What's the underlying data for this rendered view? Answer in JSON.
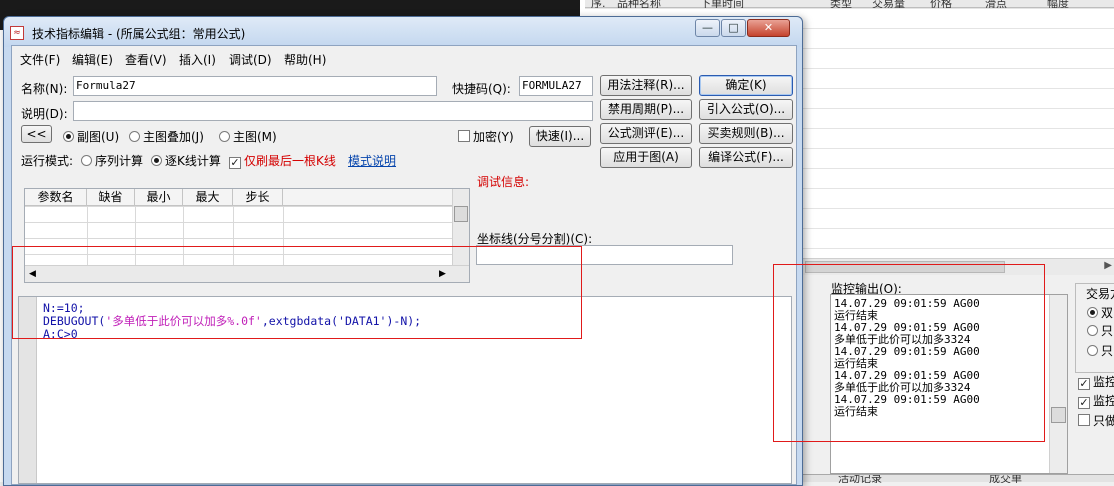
{
  "background": {
    "grid_headers": [
      "序.",
      "品种名称",
      "下单时间",
      "类型",
      "交易量",
      "价格",
      "滑点",
      "幅度"
    ],
    "monitor": {
      "label": "监控输出(O):",
      "lines": [
        "14.07.29 09:01:59 AG00",
        "运行结束",
        "14.07.29 09:01:59 AG00",
        "多单低于此价可以加多3324",
        "14.07.29 09:01:59 AG00",
        "运行结束",
        "14.07.29 09:01:59 AG00",
        "多单低于此价可以加多3324",
        "14.07.29 09:01:59 AG00",
        "运行结束"
      ]
    },
    "trade_group": {
      "label": "交易方",
      "radios": [
        "双",
        "只",
        "只"
      ]
    },
    "checks": [
      "监控",
      "监控",
      "只做"
    ],
    "bottom_tabs": [
      "活动记录",
      "成交单"
    ]
  },
  "window": {
    "title": "技术指标编辑 - (所属公式组：常用公式)",
    "caption_buttons": {
      "minimize": "—",
      "maximize": "□",
      "close": "✕"
    },
    "menu": [
      "文件(F)",
      "编辑(E)",
      "查看(V)",
      "插入(I)",
      "调试(D)",
      "帮助(H)"
    ],
    "name_label": "名称(N):",
    "name_value": "Formula27",
    "shortcut_label": "快捷码(Q):",
    "shortcut_value": "FORMULA27",
    "desc_label": "说明(D):",
    "desc_value": "",
    "collapse_button": "<<",
    "chart_radios": [
      {
        "label": "副图(U)",
        "checked": true
      },
      {
        "label": "主图叠加(J)",
        "checked": false
      },
      {
        "label": "主图(M)",
        "checked": false
      }
    ],
    "encrypt_label": "加密(Y)",
    "encrypt_checked": false,
    "fast_button": "快速(I)...",
    "run_mode_label": "运行模式:",
    "run_mode_radios": [
      {
        "label": "序列计算",
        "checked": false
      },
      {
        "label": "逐K线计算",
        "checked": true
      }
    ],
    "last_bar_check_label": "仅刷最后一根K线",
    "last_bar_checked": true,
    "mode_link": "模式说明",
    "param_headers": [
      "参数名",
      "缺省",
      "最小",
      "最大",
      "步长"
    ],
    "debug_label": "调试信息:",
    "coord_label": "坐标线(分号分割)(C):",
    "coord_value": "",
    "buttons_left": [
      "用法注释(R)...",
      "禁用周期(P)...",
      "公式测评(E)...",
      "应用于图(A)"
    ],
    "buttons_right": [
      "确定(K)",
      "引入公式(O)...",
      "买卖规则(B)...",
      "编译公式(F)..."
    ],
    "code": {
      "line1": "N:=10;",
      "line2_fn": "DEBUGOUT(",
      "line2_str": "'多单低于此价可以加多%.0f'",
      "line2_rest": ",extgbdata('DATA1')-N);",
      "line3": "A:C>0"
    }
  }
}
